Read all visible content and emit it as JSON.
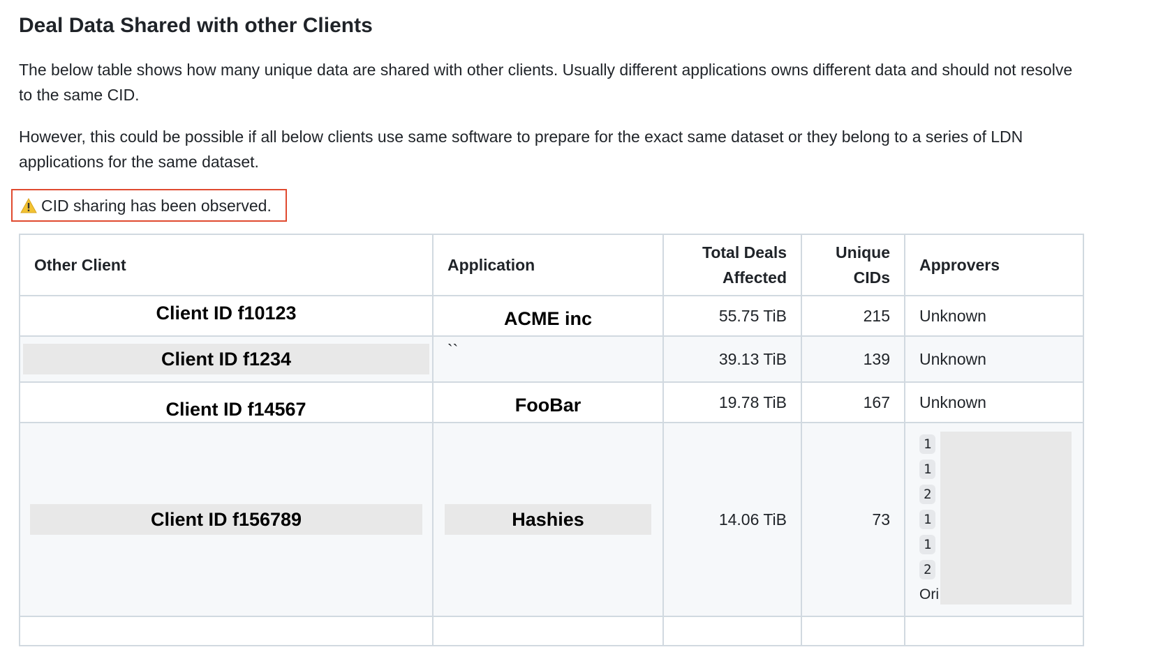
{
  "section": {
    "title": "Deal Data Shared with other Clients",
    "paragraph1": "The below table shows how many unique data are shared with other clients. Usually different applications owns different data and should not resolve to the same CID.",
    "paragraph2": "However, this could be possible if all below clients use same software to prepare for the exact same dataset or they belong to a series of LDN applications for the same dataset.",
    "warning": {
      "icon": "warning-icon",
      "text": "CID sharing has been observed."
    },
    "accent_colors": {
      "warning_border": "#e04a2f",
      "table_border": "#d1d9e0",
      "alt_row": "#f6f8fa"
    }
  },
  "table": {
    "headers": {
      "other_client": "Other Client",
      "application": "Application",
      "total_deals_line1": "Total Deals",
      "total_deals_line2": "Affected",
      "unique_cids_line1": "Unique",
      "unique_cids_line2": "CIDs",
      "approvers": "Approvers"
    },
    "rows": [
      {
        "client": "Client ID f10123",
        "application": "ACME inc",
        "total": "55.75 TiB",
        "cids": "215",
        "approvers": "Unknown"
      },
      {
        "client": "Client ID f1234",
        "application": "``",
        "total": "39.13 TiB",
        "cids": "139",
        "approvers": "Unknown"
      },
      {
        "client": "Client ID f14567",
        "application": "FooBar",
        "total": "19.78 TiB",
        "cids": "167",
        "approvers": "Unknown"
      },
      {
        "client": "Client ID f156789",
        "application": "Hashies",
        "total": "14.06 TiB",
        "cids": "73",
        "approver_badges": [
          "1",
          "1",
          "2",
          "1",
          "1",
          "2"
        ],
        "approver_tail": "Ori"
      }
    ]
  }
}
